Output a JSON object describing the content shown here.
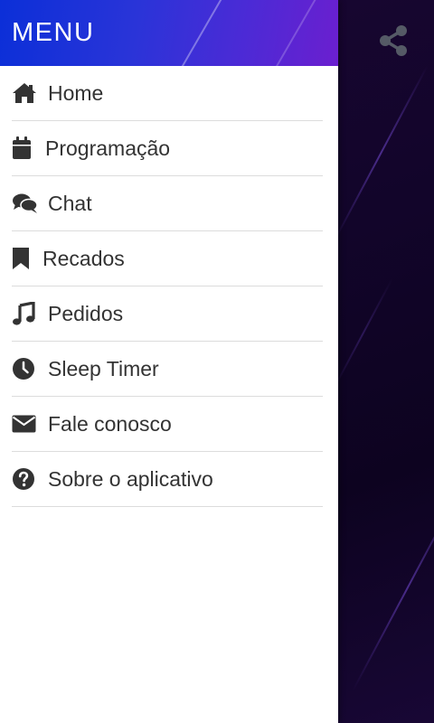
{
  "drawer": {
    "title": "MENU",
    "items": [
      {
        "label": "Home",
        "icon": "home-icon"
      },
      {
        "label": "Programação",
        "icon": "calendar-icon"
      },
      {
        "label": "Chat",
        "icon": "chat-icon"
      },
      {
        "label": "Recados",
        "icon": "bookmark-icon"
      },
      {
        "label": "Pedidos",
        "icon": "music-note-icon"
      },
      {
        "label": "Sleep Timer",
        "icon": "clock-icon"
      },
      {
        "label": "Fale conosco",
        "icon": "envelope-icon"
      },
      {
        "label": "Sobre o aplicativo",
        "icon": "question-circle-icon"
      }
    ]
  },
  "topbar": {
    "share_icon": "share-icon"
  },
  "colors": {
    "header_gradient_start": "#0b2fd8",
    "header_gradient_end": "#6b1fcf",
    "background": "#12052a",
    "menu_text": "#333333",
    "icon": "#333333",
    "divider": "#dcdcdc"
  }
}
